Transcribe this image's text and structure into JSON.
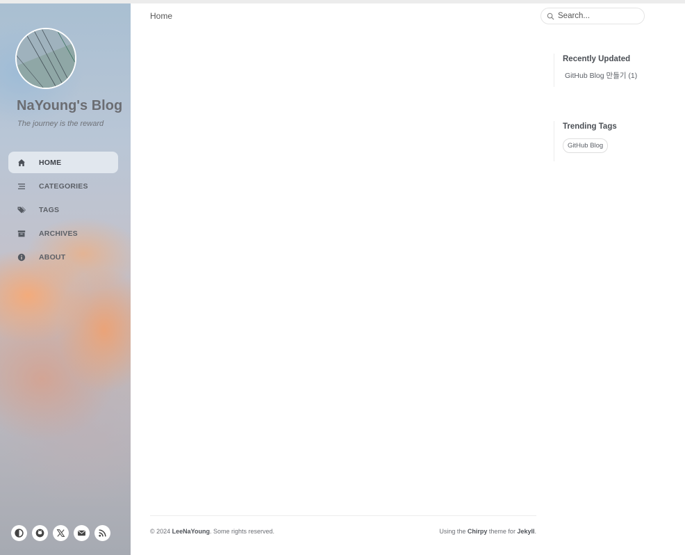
{
  "site": {
    "title": "NaYoung's Blog",
    "subtitle": "The journey is the reward"
  },
  "nav": {
    "items": [
      {
        "label": "HOME",
        "icon": "home-icon",
        "active": true
      },
      {
        "label": "CATEGORIES",
        "icon": "stream-icon",
        "active": false
      },
      {
        "label": "TAGS",
        "icon": "tags-icon",
        "active": false
      },
      {
        "label": "ARCHIVES",
        "icon": "archive-icon",
        "active": false
      },
      {
        "label": "ABOUT",
        "icon": "info-circle-icon",
        "active": false
      }
    ]
  },
  "social": [
    "mode-toggle-icon",
    "github-icon",
    "x-twitter-icon",
    "email-icon",
    "rss-icon"
  ],
  "topbar": {
    "breadcrumb": "Home",
    "search_placeholder": "Search..."
  },
  "panel": {
    "recent_heading": "Recently Updated",
    "recent_items": [
      "GitHub Blog 만들기 (1)"
    ],
    "tags_heading": "Trending Tags",
    "tags": [
      "GitHub Blog"
    ]
  },
  "footer": {
    "copyright_prefix": "© 2024 ",
    "author": "LeeNaYoung",
    "rights": ". Some rights reserved.",
    "using": "Using the ",
    "theme": "Chirpy",
    "theme_for": " theme for ",
    "engine": "Jekyll",
    "period": "."
  },
  "colors": {
    "nav_active_bg": "#f0f4f8",
    "text": "#34343c",
    "muted": "#6b6e74"
  }
}
